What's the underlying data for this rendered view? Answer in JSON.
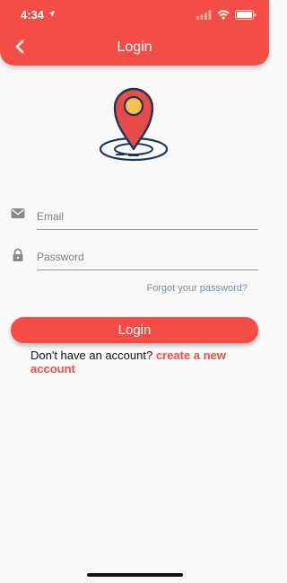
{
  "status_bar": {
    "time": "4:34"
  },
  "header": {
    "title": "Login"
  },
  "form": {
    "email_placeholder": "Email",
    "password_placeholder": "Password",
    "forgot_label": "Forgot your password?",
    "login_label": "Login"
  },
  "signup": {
    "prompt": "Don't have an account? ",
    "link_label": "create a new account"
  },
  "colors": {
    "accent": "#f44d45",
    "link_muted": "#6f8fa8",
    "pin_fill": "#e84b4b",
    "pin_dot": "#f7c24b",
    "outline": "#1d3557"
  }
}
